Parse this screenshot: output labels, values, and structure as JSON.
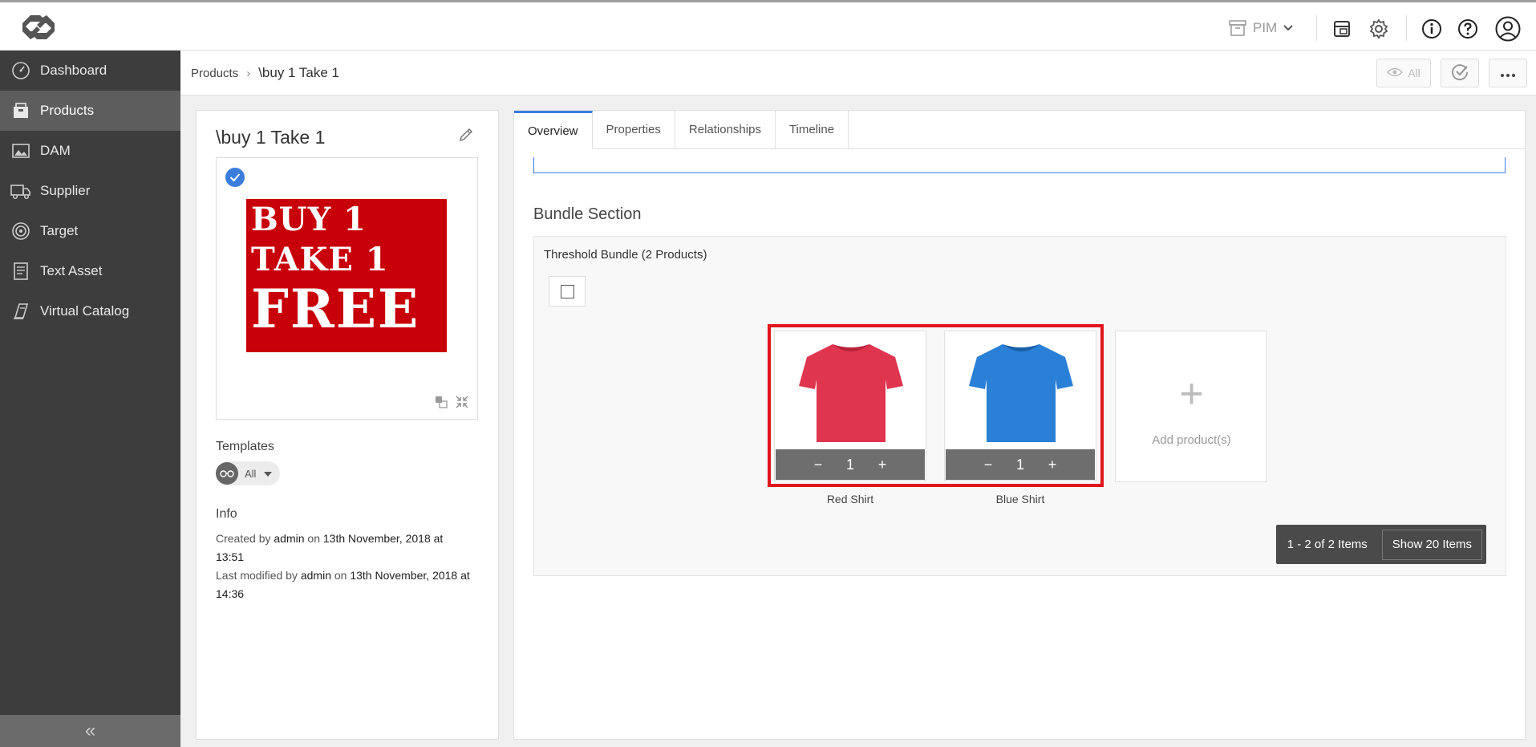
{
  "header": {
    "module_label": "PIM",
    "icons": [
      "logo-icon",
      "archive-icon",
      "gear-icon",
      "info-icon",
      "help-icon",
      "user-icon"
    ]
  },
  "sidebar": {
    "items": [
      {
        "label": "Dashboard",
        "icon": "dashboard-icon"
      },
      {
        "label": "Products",
        "icon": "products-icon"
      },
      {
        "label": "DAM",
        "icon": "image-icon"
      },
      {
        "label": "Supplier",
        "icon": "truck-icon"
      },
      {
        "label": "Target",
        "icon": "target-icon"
      },
      {
        "label": "Text Asset",
        "icon": "document-icon"
      },
      {
        "label": "Virtual Catalog",
        "icon": "catalog-icon"
      }
    ],
    "collapse_glyph": "«"
  },
  "breadcrumb": {
    "root": "Products",
    "separator": "›",
    "current": "\\buy 1 Take 1",
    "view_label": "All"
  },
  "product": {
    "title": "\\buy 1 Take 1",
    "image_text": [
      "BUY 1",
      "TAKE 1",
      "FREE"
    ],
    "templates_heading": "Templates",
    "template_value": "All",
    "info_heading": "Info",
    "created_prefix": "Created by",
    "created_user": "admin",
    "created_on": "on",
    "created_date": "13th November, 2018 at 13:51",
    "modified_prefix": "Last modified by",
    "modified_user": "admin",
    "modified_on": "on",
    "modified_date": "13th November, 2018 at 14:36"
  },
  "tabs": [
    {
      "label": "Overview"
    },
    {
      "label": "Properties"
    },
    {
      "label": "Relationships"
    },
    {
      "label": "Timeline"
    }
  ],
  "bundle": {
    "section_title": "Bundle Section",
    "name": "Threshold Bundle (2 Products)",
    "products": [
      {
        "name": "Red Shirt",
        "qty": "1",
        "color": "#e0354f"
      },
      {
        "name": "Blue Shirt",
        "qty": "1",
        "color": "#2a7fd6"
      }
    ],
    "minus": "−",
    "plus": "+",
    "add_label": "Add product(s)",
    "add_glyph": "+",
    "pager_count": "1 - 2 of 2 Items",
    "pager_show": "Show 20 Items"
  },
  "colors": {
    "accent": "#3b7ddd",
    "highlight": "#e0161c",
    "sidebar": "#3d3d3d"
  }
}
